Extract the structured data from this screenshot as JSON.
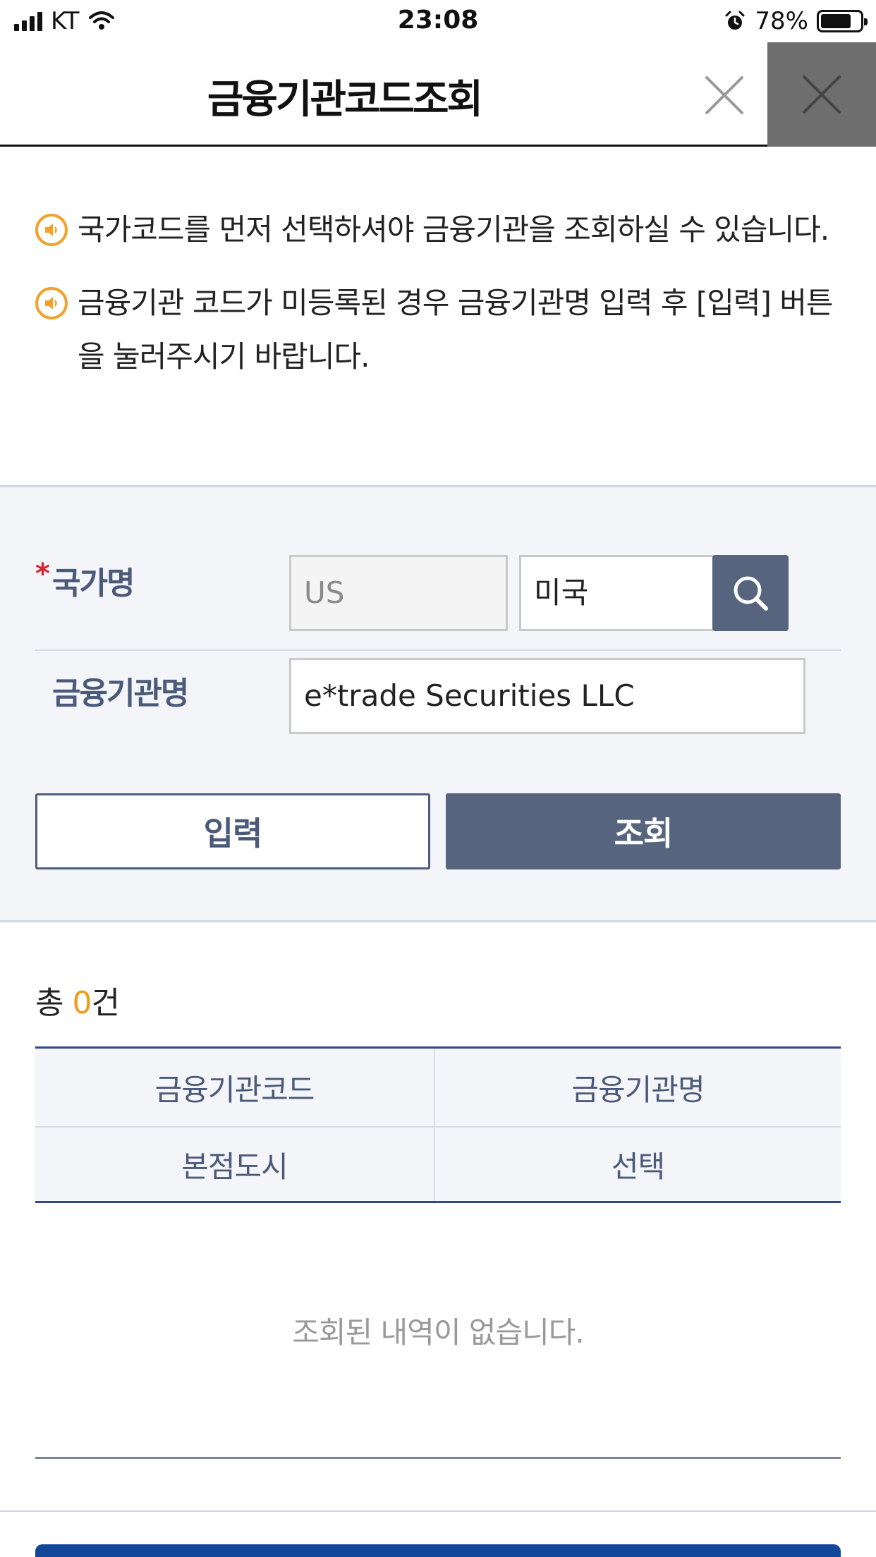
{
  "status_bar": {
    "carrier": "KT",
    "time": "23:08",
    "battery": "78%",
    "battery_level": 0.78
  },
  "header": {
    "title": "금융기관코드조회"
  },
  "notices": [
    "국가코드를 먼저 선택하셔야 금융기관을 조회하실 수 있습니다.",
    "금융기관 코드가 미등록된 경우 금융기관명 입력 후 [입력] 버튼을 눌러주시기 바랍니다."
  ],
  "form": {
    "required_mark": "*",
    "country_label": "국가명",
    "country_code": "US",
    "country_name": "미국",
    "institution_label": "금융기관명",
    "institution_value": "e*trade Securities LLC",
    "input_button": "입력",
    "search_button": "조회"
  },
  "results": {
    "count_prefix": "총 ",
    "count": "0",
    "count_suffix": "건",
    "headers": [
      "금융기관코드",
      "금융기관명",
      "본점도시",
      "선택"
    ],
    "empty_message": "조회된 내역이 없습니다."
  },
  "colors": {
    "accent_navy": "#56647d",
    "notice_orange": "#f2a22a",
    "count_orange": "#f29a1e",
    "table_border": "#2c4a8c",
    "footer_blue": "#13479a"
  }
}
